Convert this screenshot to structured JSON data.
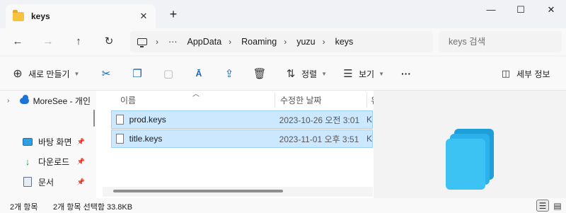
{
  "window": {
    "tab_title": "keys",
    "tab_close": "✕",
    "new_tab": "+",
    "minimize": "—",
    "maximize": "☐",
    "close": "✕"
  },
  "nav": {
    "back": "←",
    "forward": "→",
    "up": "↑",
    "refresh": "↻"
  },
  "address": {
    "ellipsis": "···",
    "separator": "›",
    "crumbs": [
      "AppData",
      "Roaming",
      "yuzu",
      "keys"
    ]
  },
  "search": {
    "placeholder": "keys 검색"
  },
  "toolbar": {
    "new_label": "새로 만들기",
    "sort_label": "정렬",
    "view_label": "보기",
    "more_label": "···",
    "details_label": "세부 정보"
  },
  "sidebar": {
    "items": [
      {
        "label": "MoreSee - 개인"
      },
      {
        "label": "바탕 화면"
      },
      {
        "label": "다운로드"
      },
      {
        "label": "문서"
      }
    ]
  },
  "file_list": {
    "columns": [
      "이름",
      "수정한 날짜",
      "유"
    ],
    "files": [
      {
        "name": "prod.keys",
        "date": "2023-10-26 오전 3:01",
        "type": "K"
      },
      {
        "name": "title.keys",
        "date": "2023-11-01 오후 3:51",
        "type": "K"
      }
    ]
  },
  "status": {
    "item_count": "2개 항목",
    "selection": "2개 항목 선택함 33.8KB"
  },
  "colors": {
    "selection_bg": "#cce8ff",
    "selection_border": "#99d1ff",
    "accent": "#1a61b8"
  }
}
